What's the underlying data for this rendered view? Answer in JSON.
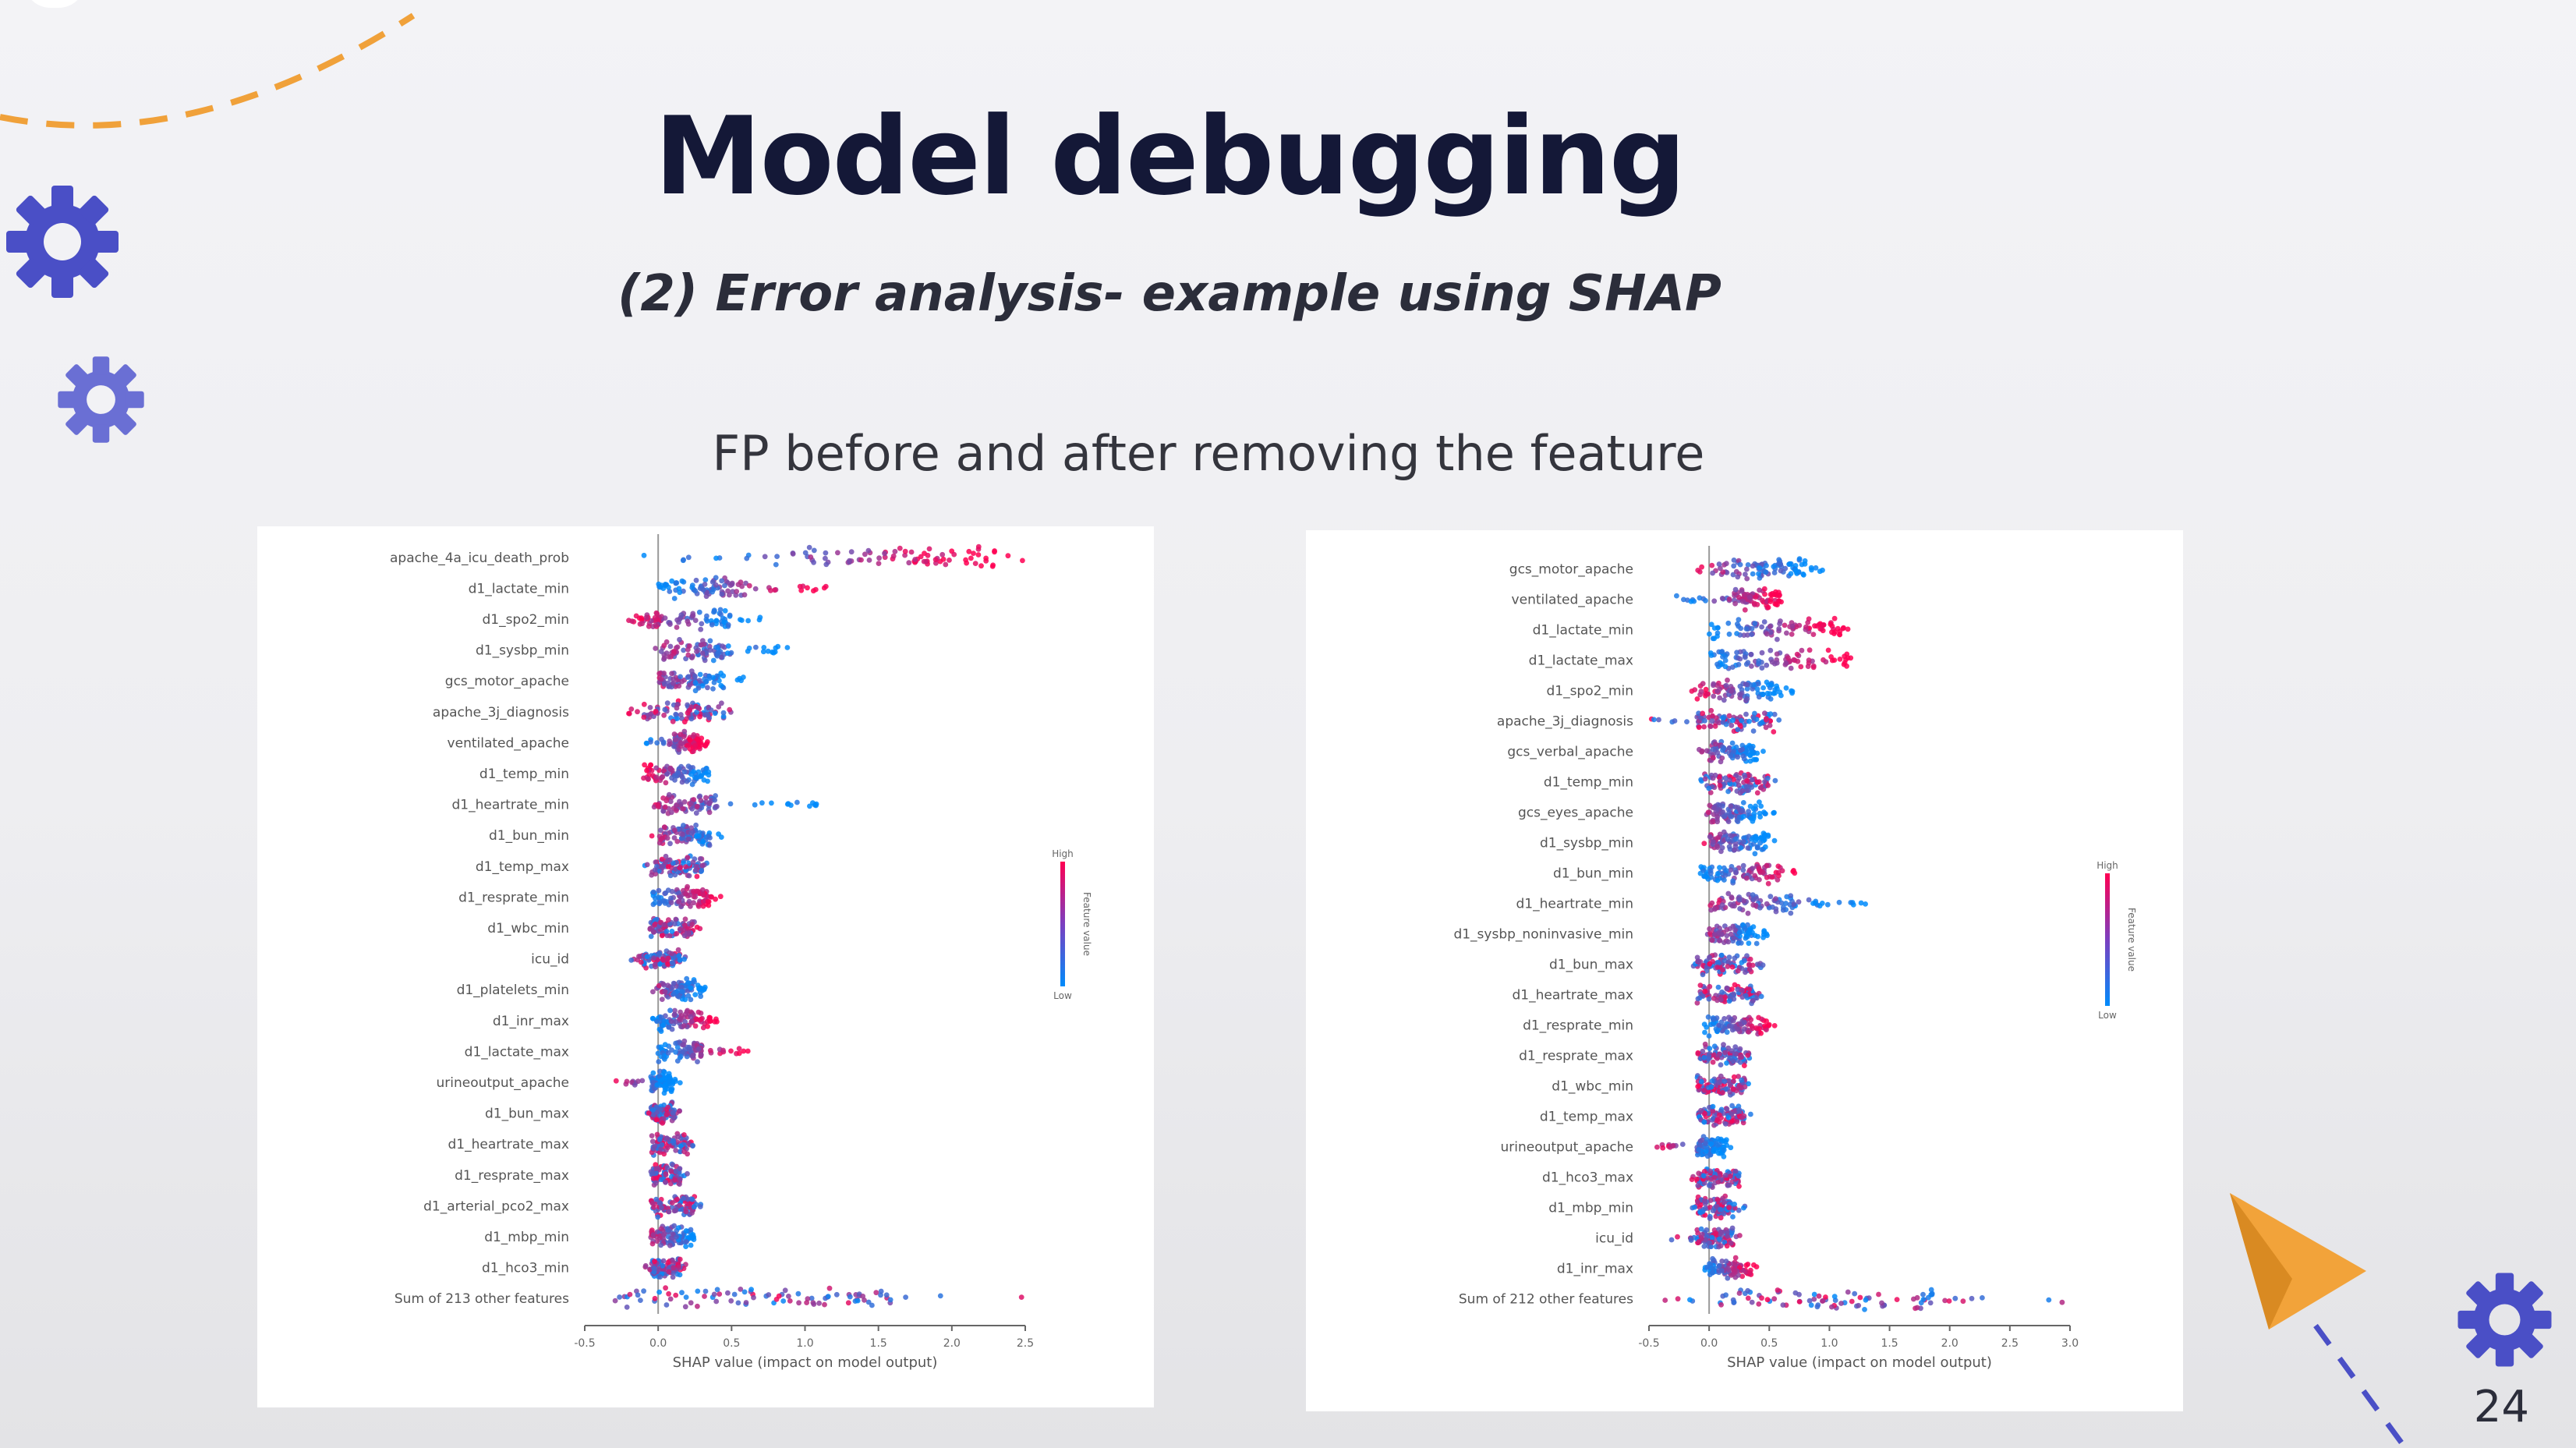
{
  "slide": {
    "title": "Model debugging",
    "subtitle": "(2) Error analysis- example using SHAP",
    "caption": "FP before and after removing the feature",
    "page_number": "24"
  },
  "colors": {
    "gear": "#4a4fc6",
    "dash_orange": "#f0a13a",
    "plane": "#f2a33a",
    "dash_blue": "#4a4fc6",
    "shap_high": "#ff0052",
    "shap_low": "#008bfb"
  },
  "icons": [
    "gear-icon",
    "paper-plane-icon"
  ],
  "chart_data": [
    {
      "type": "scatter",
      "subtype": "shap-beeswarm",
      "xlabel": "SHAP value (impact on model output)",
      "xticks": [
        "-0.5",
        "0.0",
        "0.5",
        "1.0",
        "1.5",
        "2.0",
        "2.5"
      ],
      "xlim": [
        -0.5,
        2.5
      ],
      "colorbar": {
        "label": "Feature value",
        "high": "High",
        "low": "Low"
      },
      "features": [
        {
          "name": "apache_4a_icu_death_prob",
          "min": -0.1,
          "max": 2.5,
          "core": [
            0.8,
            2.3
          ],
          "bias": "high-right"
        },
        {
          "name": "d1_lactate_min",
          "min": -0.05,
          "max": 1.2,
          "core": [
            0.0,
            0.6
          ],
          "bias": "high-right"
        },
        {
          "name": "d1_spo2_min",
          "min": -0.2,
          "max": 0.7,
          "core": [
            -0.15,
            0.5
          ],
          "bias": "high-left"
        },
        {
          "name": "d1_sysbp_min",
          "min": -0.05,
          "max": 0.9,
          "core": [
            0.0,
            0.5
          ],
          "bias": "low-right"
        },
        {
          "name": "gcs_motor_apache",
          "min": -0.05,
          "max": 0.6,
          "core": [
            0.0,
            0.45
          ],
          "bias": "low-right"
        },
        {
          "name": "apache_3j_diagnosis",
          "min": -0.2,
          "max": 0.5,
          "core": [
            -0.1,
            0.45
          ],
          "bias": "mixed"
        },
        {
          "name": "ventilated_apache",
          "min": -0.1,
          "max": 0.35,
          "core": [
            0.1,
            0.3
          ],
          "bias": "high-right"
        },
        {
          "name": "d1_temp_min",
          "min": -0.1,
          "max": 0.4,
          "core": [
            -0.1,
            0.35
          ],
          "bias": "high-left"
        },
        {
          "name": "d1_heartrate_min",
          "min": -0.05,
          "max": 1.15,
          "core": [
            0.0,
            0.4
          ],
          "bias": "low-right"
        },
        {
          "name": "d1_bun_min",
          "min": -0.05,
          "max": 0.55,
          "core": [
            0.0,
            0.35
          ],
          "bias": "low-right"
        },
        {
          "name": "d1_temp_max",
          "min": -0.1,
          "max": 0.35,
          "core": [
            -0.05,
            0.3
          ],
          "bias": "mixed"
        },
        {
          "name": "d1_resprate_min",
          "min": -0.1,
          "max": 0.45,
          "core": [
            -0.05,
            0.35
          ],
          "bias": "high-right"
        },
        {
          "name": "d1_wbc_min",
          "min": -0.1,
          "max": 0.3,
          "core": [
            -0.05,
            0.25
          ],
          "bias": "mixed"
        },
        {
          "name": "icu_id",
          "min": -0.2,
          "max": 0.2,
          "core": [
            -0.1,
            0.15
          ],
          "bias": "mixed"
        },
        {
          "name": "d1_platelets_min",
          "min": -0.05,
          "max": 0.35,
          "core": [
            0.0,
            0.3
          ],
          "bias": "low-right"
        },
        {
          "name": "d1_inr_max",
          "min": -0.05,
          "max": 0.4,
          "core": [
            0.0,
            0.35
          ],
          "bias": "high-right"
        },
        {
          "name": "d1_lactate_max",
          "min": -0.05,
          "max": 0.65,
          "core": [
            0.0,
            0.3
          ],
          "bias": "high-right"
        },
        {
          "name": "urineoutput_apache",
          "min": -0.35,
          "max": 0.15,
          "core": [
            -0.05,
            0.1
          ],
          "bias": "high-left"
        },
        {
          "name": "d1_bun_max",
          "min": -0.1,
          "max": 0.15,
          "core": [
            -0.05,
            0.12
          ],
          "bias": "mixed"
        },
        {
          "name": "d1_heartrate_max",
          "min": -0.05,
          "max": 0.25,
          "core": [
            -0.05,
            0.2
          ],
          "bias": "mixed"
        },
        {
          "name": "d1_resprate_max",
          "min": -0.05,
          "max": 0.2,
          "core": [
            -0.05,
            0.15
          ],
          "bias": "mixed"
        },
        {
          "name": "d1_arterial_pco2_max",
          "min": -0.05,
          "max": 0.3,
          "core": [
            -0.05,
            0.25
          ],
          "bias": "mixed"
        },
        {
          "name": "d1_mbp_min",
          "min": -0.05,
          "max": 0.3,
          "core": [
            -0.05,
            0.25
          ],
          "bias": "low-right"
        },
        {
          "name": "d1_hco3_min",
          "min": -0.1,
          "max": 0.2,
          "core": [
            -0.05,
            0.15
          ],
          "bias": "mixed"
        },
        {
          "name": "Sum of 213 other features",
          "min": -0.4,
          "max": 2.5,
          "core": [
            -0.3,
            1.6
          ],
          "bias": "mixed"
        }
      ]
    },
    {
      "type": "scatter",
      "subtype": "shap-beeswarm",
      "xlabel": "SHAP value (impact on model output)",
      "xticks": [
        "-0.5",
        "0.0",
        "0.5",
        "1.0",
        "1.5",
        "2.0",
        "2.5",
        "3.0"
      ],
      "xlim": [
        -0.5,
        3.0
      ],
      "colorbar": {
        "label": "Feature value",
        "high": "High",
        "low": "Low"
      },
      "features": [
        {
          "name": "gcs_motor_apache",
          "min": -0.1,
          "max": 1.0,
          "core": [
            0.0,
            0.8
          ],
          "bias": "low-right"
        },
        {
          "name": "ventilated_apache",
          "min": -0.3,
          "max": 0.7,
          "core": [
            0.2,
            0.6
          ],
          "bias": "high-right"
        },
        {
          "name": "d1_lactate_min",
          "min": -0.05,
          "max": 1.2,
          "core": [
            0.0,
            1.1
          ],
          "bias": "high-right"
        },
        {
          "name": "d1_lactate_max",
          "min": -0.05,
          "max": 1.25,
          "core": [
            0.0,
            1.15
          ],
          "bias": "high-right"
        },
        {
          "name": "d1_spo2_min",
          "min": -0.15,
          "max": 0.7,
          "core": [
            -0.1,
            0.6
          ],
          "bias": "high-left"
        },
        {
          "name": "apache_3j_diagnosis",
          "min": -0.6,
          "max": 0.6,
          "core": [
            -0.1,
            0.55
          ],
          "bias": "mixed"
        },
        {
          "name": "gcs_verbal_apache",
          "min": -0.1,
          "max": 0.45,
          "core": [
            0.0,
            0.4
          ],
          "bias": "low-right"
        },
        {
          "name": "d1_temp_min",
          "min": -0.1,
          "max": 0.55,
          "core": [
            -0.05,
            0.5
          ],
          "bias": "mixed"
        },
        {
          "name": "gcs_eyes_apache",
          "min": -0.05,
          "max": 0.55,
          "core": [
            0.0,
            0.45
          ],
          "bias": "low-right"
        },
        {
          "name": "d1_sysbp_min",
          "min": -0.05,
          "max": 0.55,
          "core": [
            0.0,
            0.5
          ],
          "bias": "low-right"
        },
        {
          "name": "d1_bun_min",
          "min": -0.1,
          "max": 0.75,
          "core": [
            -0.1,
            0.6
          ],
          "bias": "high-right"
        },
        {
          "name": "d1_heartrate_min",
          "min": -0.05,
          "max": 1.35,
          "core": [
            0.0,
            0.7
          ],
          "bias": "low-right"
        },
        {
          "name": "d1_sysbp_noninvasive_min",
          "min": -0.05,
          "max": 0.5,
          "core": [
            0.0,
            0.4
          ],
          "bias": "low-right"
        },
        {
          "name": "d1_bun_max",
          "min": -0.15,
          "max": 0.45,
          "core": [
            -0.1,
            0.35
          ],
          "bias": "mixed"
        },
        {
          "name": "d1_heartrate_max",
          "min": -0.1,
          "max": 0.45,
          "core": [
            -0.1,
            0.4
          ],
          "bias": "mixed"
        },
        {
          "name": "d1_resprate_min",
          "min": -0.05,
          "max": 0.6,
          "core": [
            -0.05,
            0.5
          ],
          "bias": "high-right"
        },
        {
          "name": "d1_resprate_max",
          "min": -0.1,
          "max": 0.35,
          "core": [
            -0.1,
            0.3
          ],
          "bias": "mixed"
        },
        {
          "name": "d1_wbc_min",
          "min": -0.1,
          "max": 0.35,
          "core": [
            -0.1,
            0.3
          ],
          "bias": "mixed"
        },
        {
          "name": "d1_temp_max",
          "min": -0.1,
          "max": 0.35,
          "core": [
            -0.1,
            0.3
          ],
          "bias": "mixed"
        },
        {
          "name": "urineoutput_apache",
          "min": -0.45,
          "max": 0.2,
          "core": [
            -0.1,
            0.15
          ],
          "bias": "high-left"
        },
        {
          "name": "d1_hco3_max",
          "min": -0.15,
          "max": 0.3,
          "core": [
            -0.1,
            0.25
          ],
          "bias": "mixed"
        },
        {
          "name": "d1_mbp_min",
          "min": -0.15,
          "max": 0.3,
          "core": [
            -0.1,
            0.25
          ],
          "bias": "mixed"
        },
        {
          "name": "icu_id",
          "min": -0.5,
          "max": 0.3,
          "core": [
            -0.1,
            0.2
          ],
          "bias": "mixed"
        },
        {
          "name": "d1_inr_max",
          "min": -0.05,
          "max": 0.4,
          "core": [
            0.0,
            0.35
          ],
          "bias": "high-right"
        },
        {
          "name": "Sum of 212 other features",
          "min": -0.4,
          "max": 3.0,
          "core": [
            0.0,
            2.0
          ],
          "bias": "mixed"
        }
      ]
    }
  ]
}
